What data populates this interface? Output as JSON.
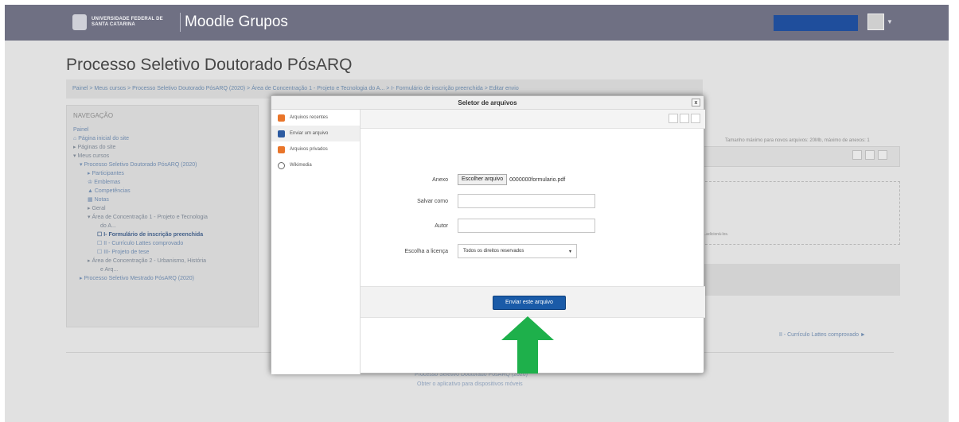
{
  "navbar": {
    "university": "UNIVERSIDADE FEDERAL DE SANTA CATARINA",
    "site_name": "Moodle Grupos"
  },
  "page": {
    "title": "Processo Seletivo Doutorado PósARQ",
    "breadcrumb": "Painel  >  Meus cursos  >  Processo Seletivo Doutorado PósARQ (2020)  >  Área de Concentração 1 - Projeto e Tecnologia do A...  >  I- Formulário de inscrição preenchida  >  Editar envio"
  },
  "navigation": {
    "heading": "NAVEGAÇÃO",
    "items": [
      {
        "label": "Painel"
      },
      {
        "label": "Página inicial do site"
      },
      {
        "label": "Páginas do site"
      },
      {
        "label": "Meus cursos"
      },
      {
        "label": "Processo Seletivo Doutorado PósARQ (2020)"
      },
      {
        "label": "Participantes"
      },
      {
        "label": "Emblemas"
      },
      {
        "label": "Competências"
      },
      {
        "label": "Notas"
      },
      {
        "label": "Geral"
      },
      {
        "label": "Área de Concentração 1 - Projeto e Tecnologia"
      },
      {
        "label": "do A..."
      },
      {
        "label": "I- Formulário de inscrição preenchida"
      },
      {
        "label": "II - Currículo Lattes comprovado"
      },
      {
        "label": "III- Projeto de tese"
      },
      {
        "label": "Área de Concentração 2 - Urbanismo, História"
      },
      {
        "label": "e Arq..."
      },
      {
        "label": "Processo Seletivo Mestrado PósARQ (2020)"
      }
    ]
  },
  "background": {
    "max_size_note": "Tamanho máximo para novos arquivos: 20Mb, máximo de anexos: 1",
    "drop_hint": "...adicioná-los.",
    "next_link": "II - Currículo Lattes comprovado ►",
    "footer_line1": "Processo Seletivo Doutorado PósARQ (2020)",
    "footer_line2": "Obter o aplicativo para dispositivos móveis"
  },
  "modal": {
    "title": "Seletor de arquivos",
    "close": "x",
    "repositories": [
      {
        "label": "Arquivos recentes",
        "icon": "recent-files-icon",
        "color": "#e9752a"
      },
      {
        "label": "Enviar um arquivo",
        "icon": "upload-icon",
        "color": "#2c5aa0"
      },
      {
        "label": "Arquivos privados",
        "icon": "private-files-icon",
        "color": "#e9752a"
      },
      {
        "label": "Wikimedia",
        "icon": "wikimedia-icon",
        "color": "#666666"
      }
    ],
    "form": {
      "attachment_label": "Anexo",
      "choose_file_button": "Escolher arquivo",
      "chosen_file": "0000000formulario.pdf",
      "save_as_label": "Salvar como",
      "save_as_value": "",
      "author_label": "Autor",
      "author_value": "",
      "license_label": "Escolha a licença",
      "license_value": "Todos os direitos reservados",
      "submit_button": "Enviar este arquivo"
    }
  },
  "colors": {
    "navbar": "#6f7083",
    "submit": "#1a5ba8",
    "arrow": "#1eb04b"
  }
}
